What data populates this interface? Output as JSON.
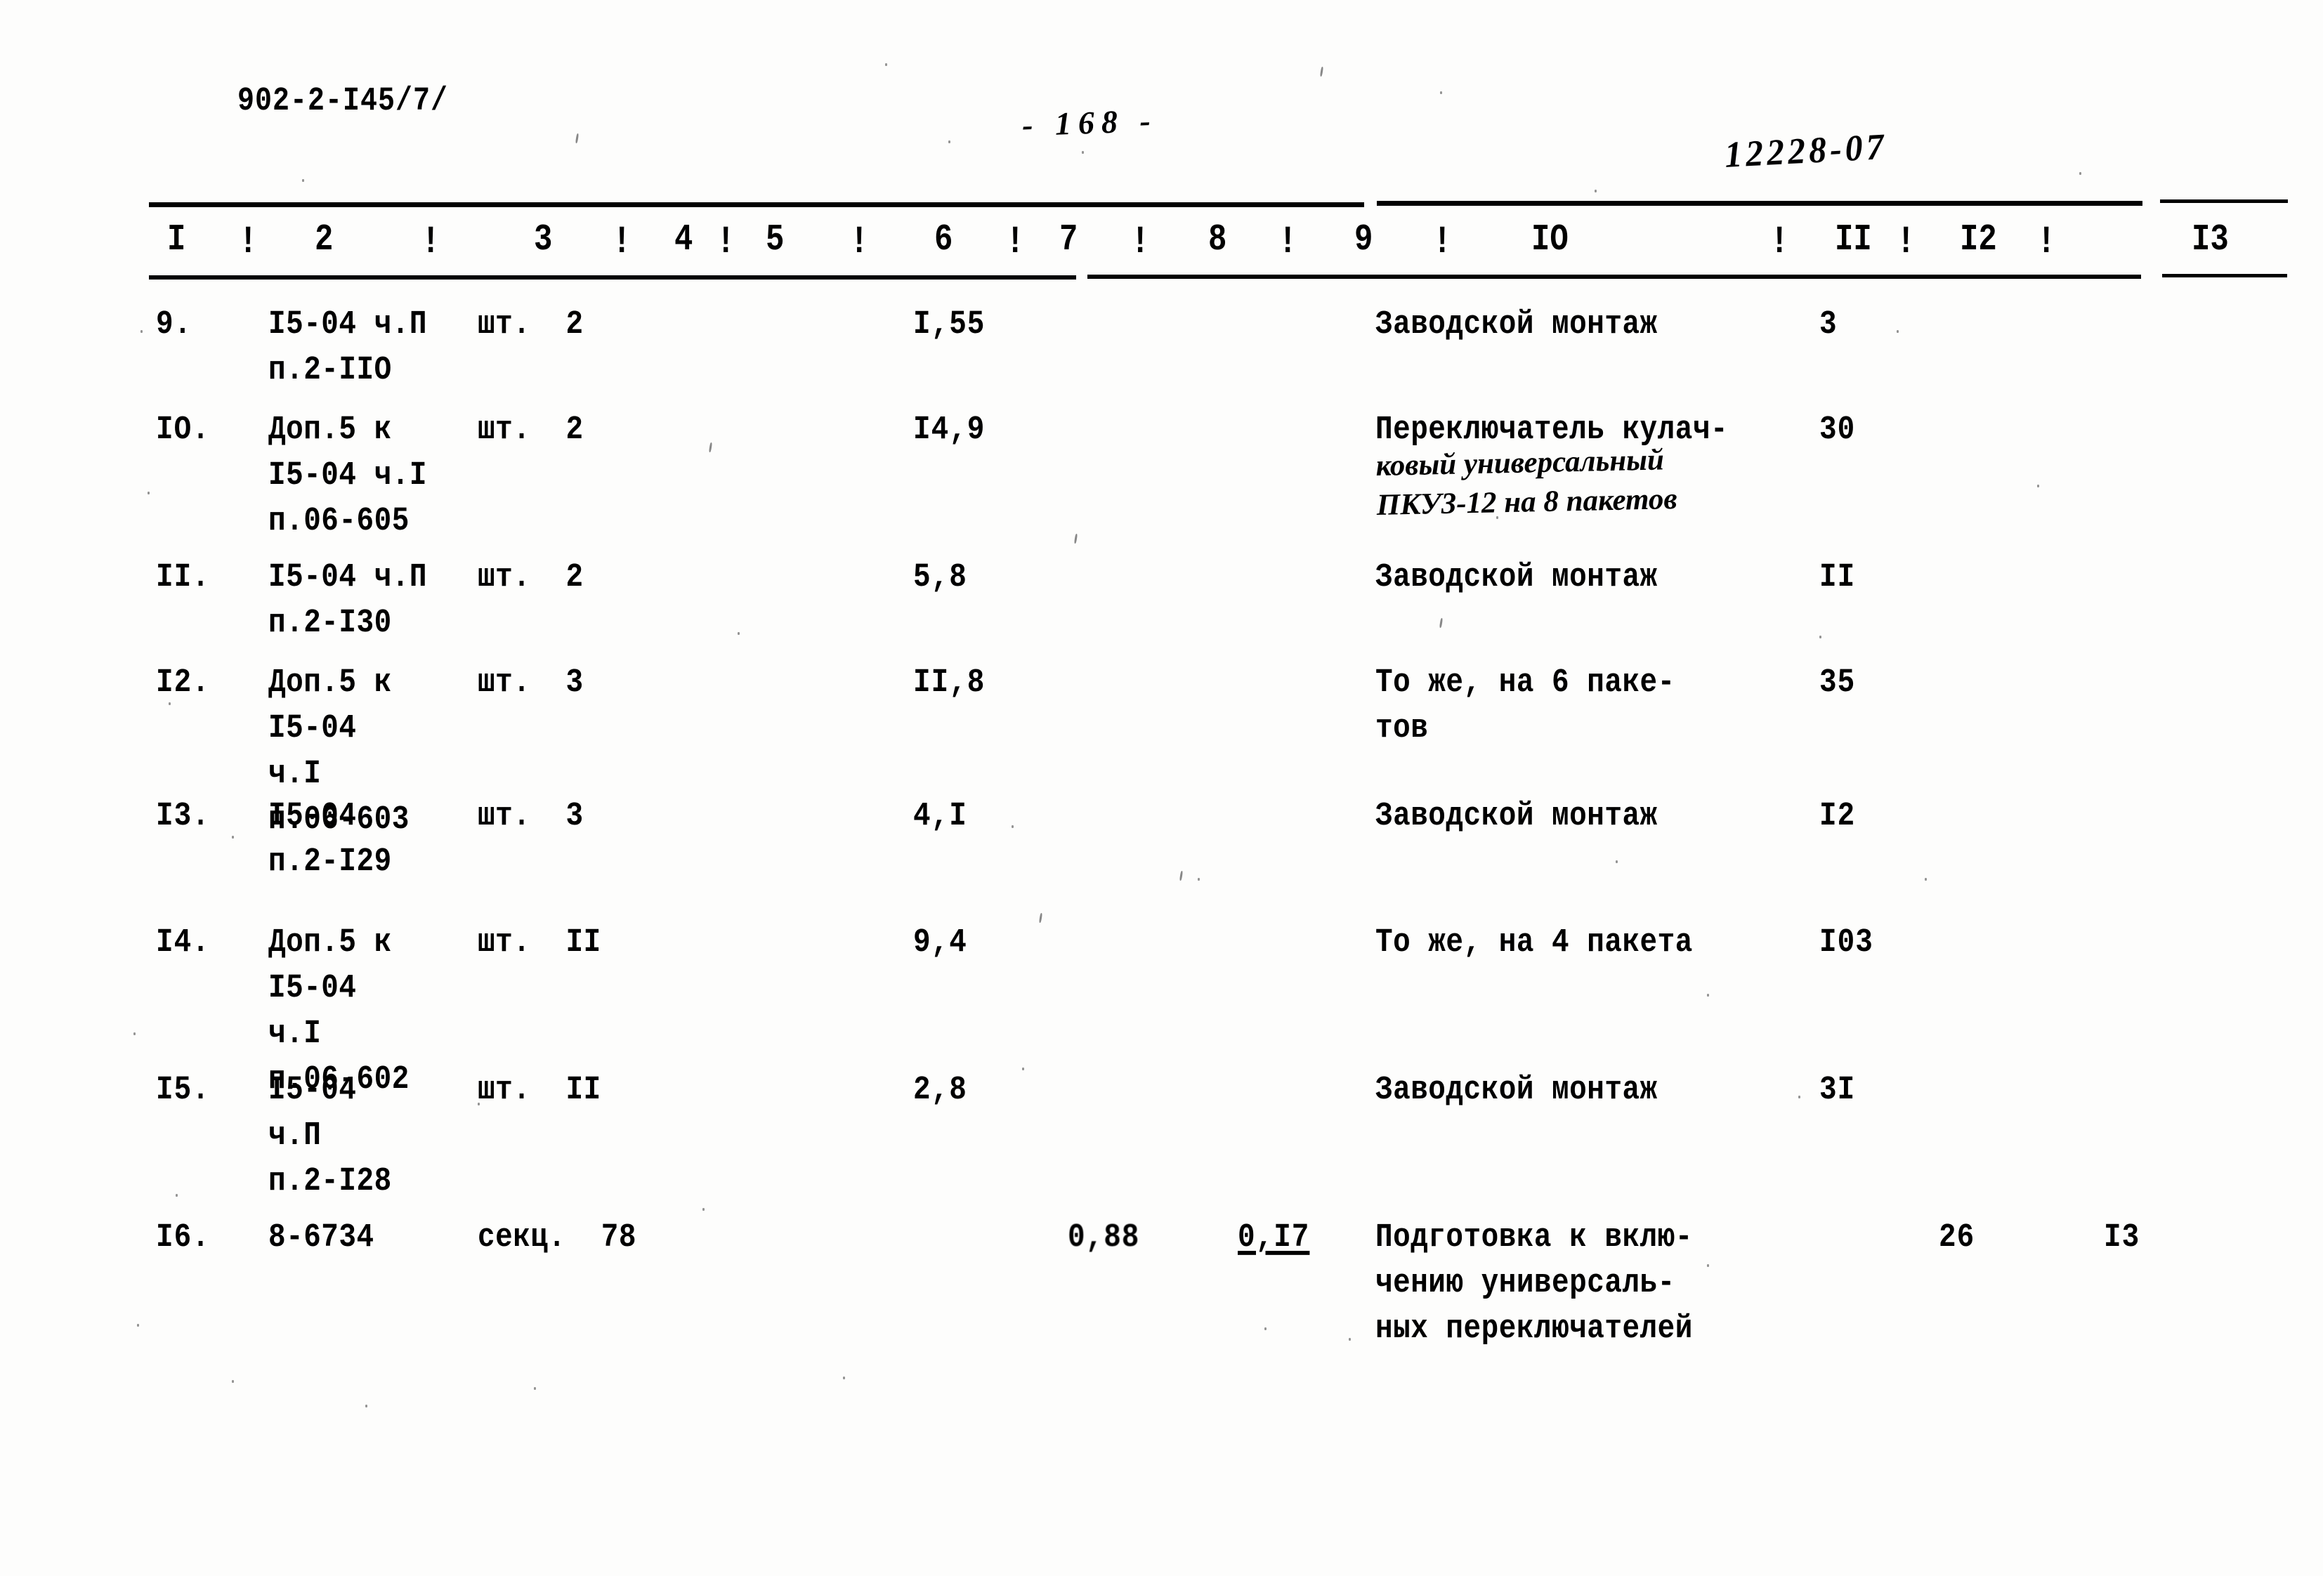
{
  "document": {
    "code": "902-2-I45/7/",
    "page_label": "- 168 -",
    "archive_number": "12228-07"
  },
  "table": {
    "column_headers": [
      "I",
      "2",
      "3",
      "4",
      "5",
      "6",
      "7",
      "8",
      "9",
      "IO",
      "II",
      "I2",
      "I3"
    ],
    "separator_glyph": "!",
    "rows": [
      {
        "no": "9.",
        "code_lines": [
          "I5-04 ч.П",
          "п.2-IIO"
        ],
        "unit": "шт.",
        "unit_qty": "2",
        "col7": "I,55",
        "col9": "",
        "description_lines": [
          "Заводской монтаж"
        ],
        "description_hand_lines": [],
        "col11": "3",
        "col12": "",
        "col13": ""
      },
      {
        "no": "IO.",
        "code_lines": [
          "Доп.5 к",
          "I5-04 ч.I",
          "п.06-605"
        ],
        "unit": "шт.",
        "unit_qty": "2",
        "col7": "I4,9",
        "col9": "",
        "description_lines": [
          "Переключатель кулач-"
        ],
        "description_hand_lines": [
          "ковый универсальный",
          "ПКУ3-12 на 8 пакетов"
        ],
        "col11": "30",
        "col12": "",
        "col13": ""
      },
      {
        "no": "II.",
        "code_lines": [
          "I5-04 ч.П",
          "п.2-I30"
        ],
        "unit": "шт.",
        "unit_qty": "2",
        "col7": "5,8",
        "col9": "",
        "description_lines": [
          "Заводской монтаж"
        ],
        "description_hand_lines": [],
        "col11": "II",
        "col12": "",
        "col13": ""
      },
      {
        "no": "I2.",
        "code_lines": [
          "Доп.5 к",
          "I5-04",
          "ч.I",
          "п.06-603"
        ],
        "unit": "шт.",
        "unit_qty": "3",
        "col7": "II,8",
        "col9": "",
        "description_lines": [
          "То же, на 6 паке-",
          "тов"
        ],
        "description_hand_lines": [],
        "col11": "35",
        "col12": "",
        "col13": ""
      },
      {
        "no": "I3.",
        "code_lines": [
          "I5-04",
          "п.2-I29"
        ],
        "unit": "шт.",
        "unit_qty": "3",
        "col7": "4,I",
        "col9": "",
        "description_lines": [
          "Заводской монтаж"
        ],
        "description_hand_lines": [],
        "col11": "I2",
        "col12": "",
        "col13": ""
      },
      {
        "no": "I4.",
        "code_lines": [
          "Доп.5 к",
          "I5-04",
          "ч.I",
          "п.06-602"
        ],
        "unit": "шт.",
        "unit_qty": "II",
        "col7": "9,4",
        "col9": "",
        "description_lines": [
          "То же, на 4 пакета"
        ],
        "description_hand_lines": [],
        "col11": "I03",
        "col12": "",
        "col13": ""
      },
      {
        "no": "I5.",
        "code_lines": [
          "I5-04",
          "ч.П",
          "п.2-I28"
        ],
        "unit": "шт.",
        "unit_qty": "II",
        "col7": "2,8",
        "col9": "",
        "description_lines": [
          "Заводской монтаж"
        ],
        "description_hand_lines": [],
        "col11": "3I",
        "col12": "",
        "col13": ""
      },
      {
        "no": "I6.",
        "code_lines": [
          "8-6734"
        ],
        "unit": "секц.",
        "unit_qty": "78",
        "col7": "",
        "col8": "0,88",
        "col9": "0,I7",
        "description_lines": [
          "Подготовка к вклю-",
          "чению универсаль-",
          "ных переключателей"
        ],
        "description_hand_lines": [],
        "col11": "",
        "col12": "26",
        "col13": "I3"
      }
    ]
  }
}
